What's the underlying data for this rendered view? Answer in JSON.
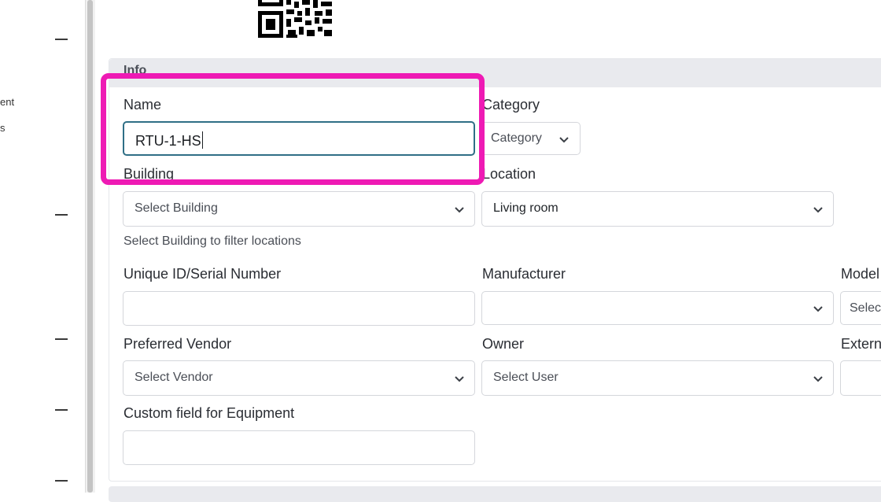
{
  "sidebar": {
    "fragments": [
      "ent",
      "s"
    ]
  },
  "card": {
    "header_title": "Info"
  },
  "form": {
    "name": {
      "label": "Name",
      "value": "RTU-1-HS"
    },
    "category": {
      "label": "Category",
      "selected": "Category"
    },
    "building": {
      "label": "Building",
      "placeholder": "Select Building",
      "help": "Select Building to filter locations"
    },
    "location": {
      "label": "Location",
      "selected": "Living room"
    },
    "serial": {
      "label": "Unique ID/Serial Number",
      "value": ""
    },
    "manufacturer": {
      "label": "Manufacturer",
      "selected": ""
    },
    "model": {
      "label": "Model",
      "placeholder": "Select"
    },
    "vendor": {
      "label": "Preferred Vendor",
      "placeholder": "Select Vendor"
    },
    "owner": {
      "label": "Owner",
      "placeholder": "Select User"
    },
    "external": {
      "label": "Extern"
    },
    "custom": {
      "label": "Custom field for Equipment",
      "value": ""
    }
  },
  "colors": {
    "highlight": "#ee1ab4",
    "focus_border": "#2f6f86",
    "header_bg": "#e9eaee"
  }
}
